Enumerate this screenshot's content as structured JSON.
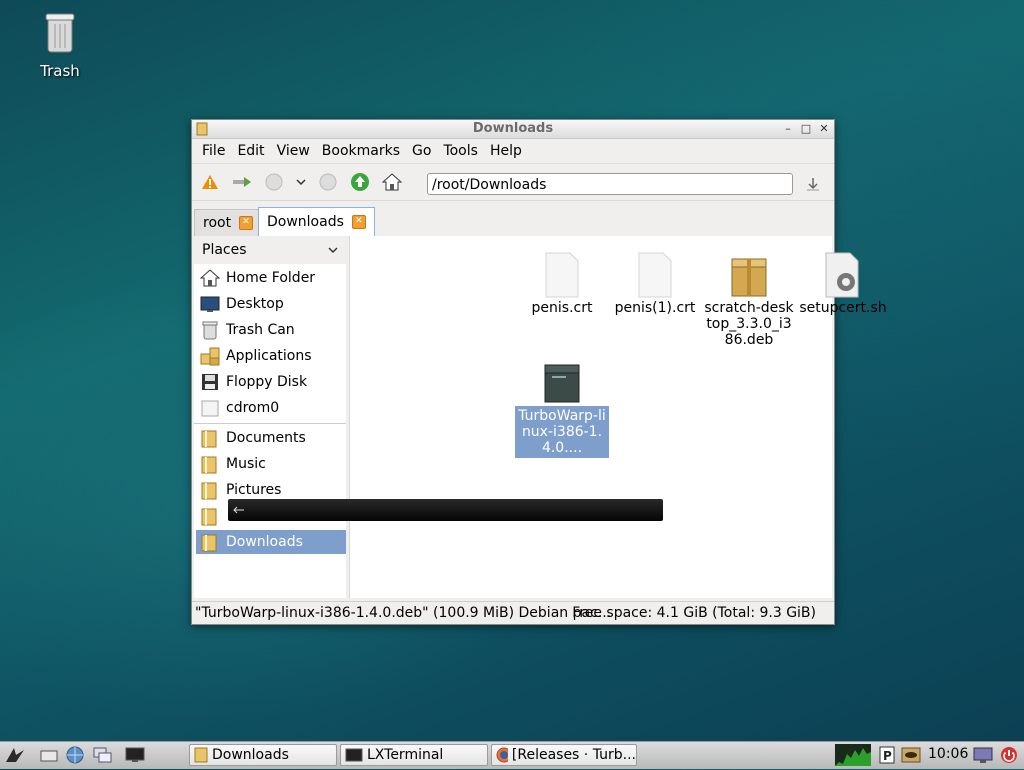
{
  "desktop": {
    "trash_label": "Trash"
  },
  "window": {
    "title": "Downloads",
    "menu": [
      "File",
      "Edit",
      "View",
      "Bookmarks",
      "Go",
      "Tools",
      "Help"
    ],
    "address": "/root/Downloads",
    "tabs": [
      {
        "label": "root"
      },
      {
        "label": "Downloads"
      }
    ],
    "places_header": "Places",
    "places": [
      {
        "label": "Home Folder",
        "icon": "home-icon"
      },
      {
        "label": "Desktop",
        "icon": "desktop-icon"
      },
      {
        "label": "Trash Can",
        "icon": "trash-icon"
      },
      {
        "label": "Applications",
        "icon": "applications-icon"
      },
      {
        "label": "Floppy Disk",
        "icon": "floppy-icon"
      },
      {
        "label": "cdrom0",
        "icon": "cdrom-icon"
      }
    ],
    "bookmarks": [
      {
        "label": "Documents"
      },
      {
        "label": "Music"
      },
      {
        "label": "Pictures"
      },
      {
        "label": ""
      },
      {
        "label": "Downloads"
      }
    ],
    "files": [
      {
        "name": "penis.crt",
        "icon": "document-icon"
      },
      {
        "name": "penis(1).crt",
        "icon": "document-icon"
      },
      {
        "name": "scratch-desktop_3.3.0_i386.deb",
        "display": "scratch-desktop_3.3.0_i386.deb",
        "icon": "package-icon"
      },
      {
        "name": "setupcert.sh",
        "icon": "script-icon"
      },
      {
        "name": "TurboWarp-linux-i386-1.4.0....",
        "icon": "package-dark-icon"
      }
    ],
    "status_left": "\"TurboWarp-linux-i386-1.4.0.deb\" (100.9 MiB) Debian pac...",
    "status_right": "Free space: 4.1 GiB (Total: 9.3 GiB)"
  },
  "taskbar": {
    "tasks": [
      {
        "label": "Downloads"
      },
      {
        "label": "LXTerminal"
      },
      {
        "label": "[Releases · Turb..."
      }
    ],
    "clock": "10:06"
  }
}
